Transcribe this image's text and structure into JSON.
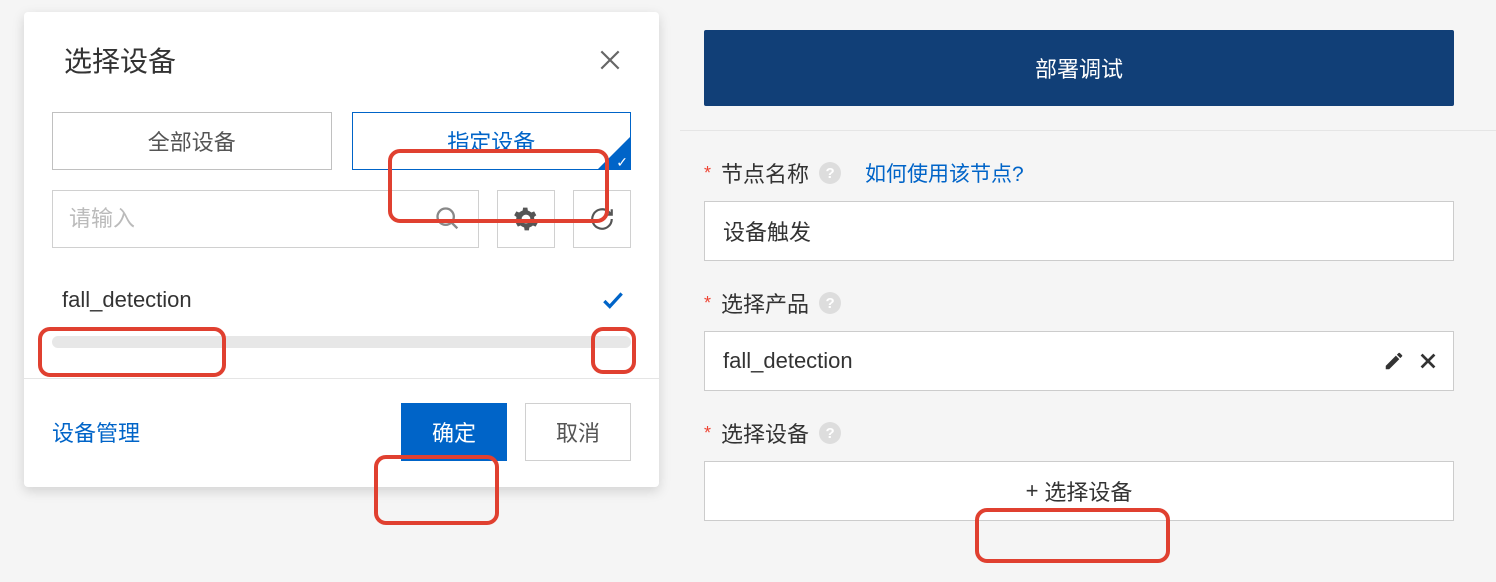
{
  "modal": {
    "title": "选择设备",
    "tabs": {
      "all": "全部设备",
      "specified": "指定设备"
    },
    "search_placeholder": "请输入",
    "devices": [
      {
        "name": "fall_detection",
        "checked": true
      }
    ],
    "footer": {
      "manage_link": "设备管理",
      "confirm": "确定",
      "cancel": "取消"
    }
  },
  "panel": {
    "banner": "部署调试",
    "node_name_label": "节点名称",
    "node_help_link": "如何使用该节点?",
    "node_name_value": "设备触发",
    "select_product_label": "选择产品",
    "product_value": "fall_detection",
    "select_device_label": "选择设备",
    "select_device_btn_prefix": "+",
    "select_device_btn_label": "选择设备"
  }
}
